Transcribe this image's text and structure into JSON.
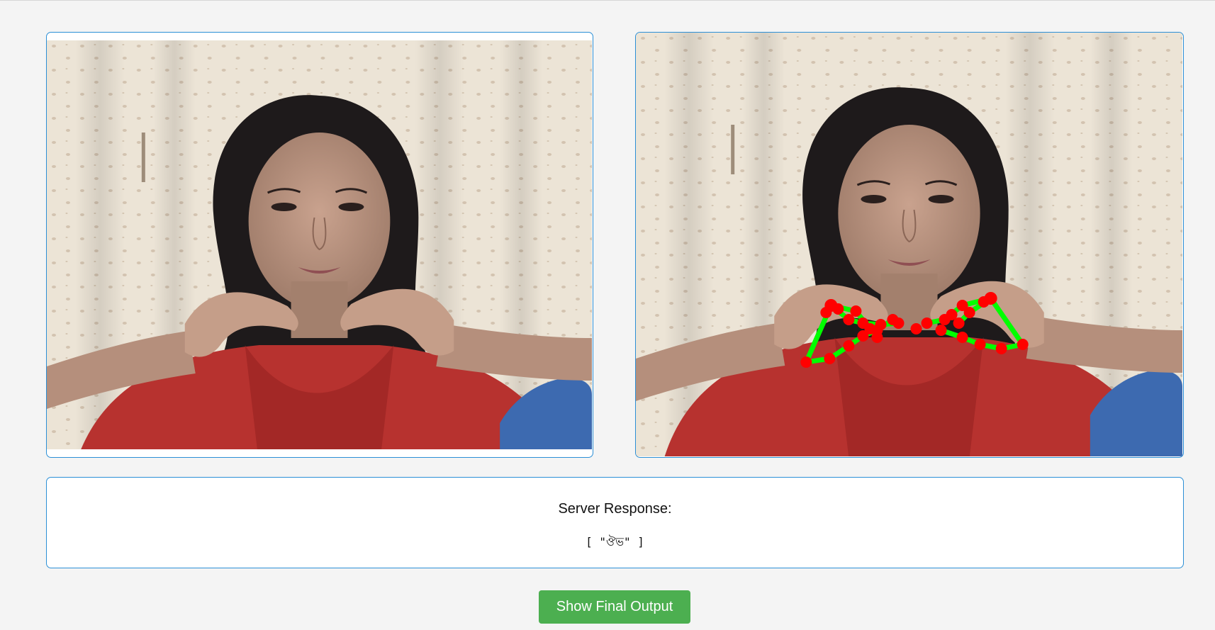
{
  "response": {
    "title": "Server Response:",
    "body": "[ \"ঔভ\" ]"
  },
  "actions": {
    "final_output_label": "Show Final Output"
  },
  "colors": {
    "accent_border": "#2b8fd6",
    "button_bg": "#4caf50",
    "landmark_point": "#ff0000",
    "landmark_line": "#00ff00"
  }
}
